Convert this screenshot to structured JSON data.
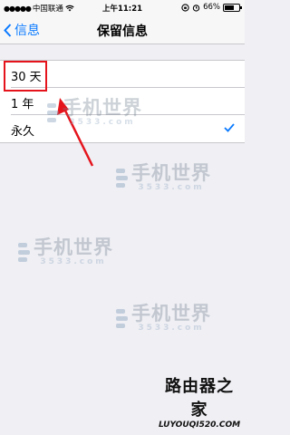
{
  "status_bar": {
    "carrier": "中国联通",
    "time": "上午11:21",
    "battery": "66%",
    "battery_level": 0.66
  },
  "nav": {
    "back_label": "信息",
    "title": "保留信息"
  },
  "options": [
    {
      "label": "30 天",
      "selected": false
    },
    {
      "label": "1 年",
      "selected": false
    },
    {
      "label": "永久",
      "selected": true
    }
  ],
  "colors": {
    "accent": "#0a7aff",
    "highlight": "#e5141c"
  },
  "watermark": {
    "main": "手机世界",
    "sub": "3533.com"
  },
  "brand": {
    "name": "路由器之家",
    "url": "LUYOUQI520.COM"
  }
}
